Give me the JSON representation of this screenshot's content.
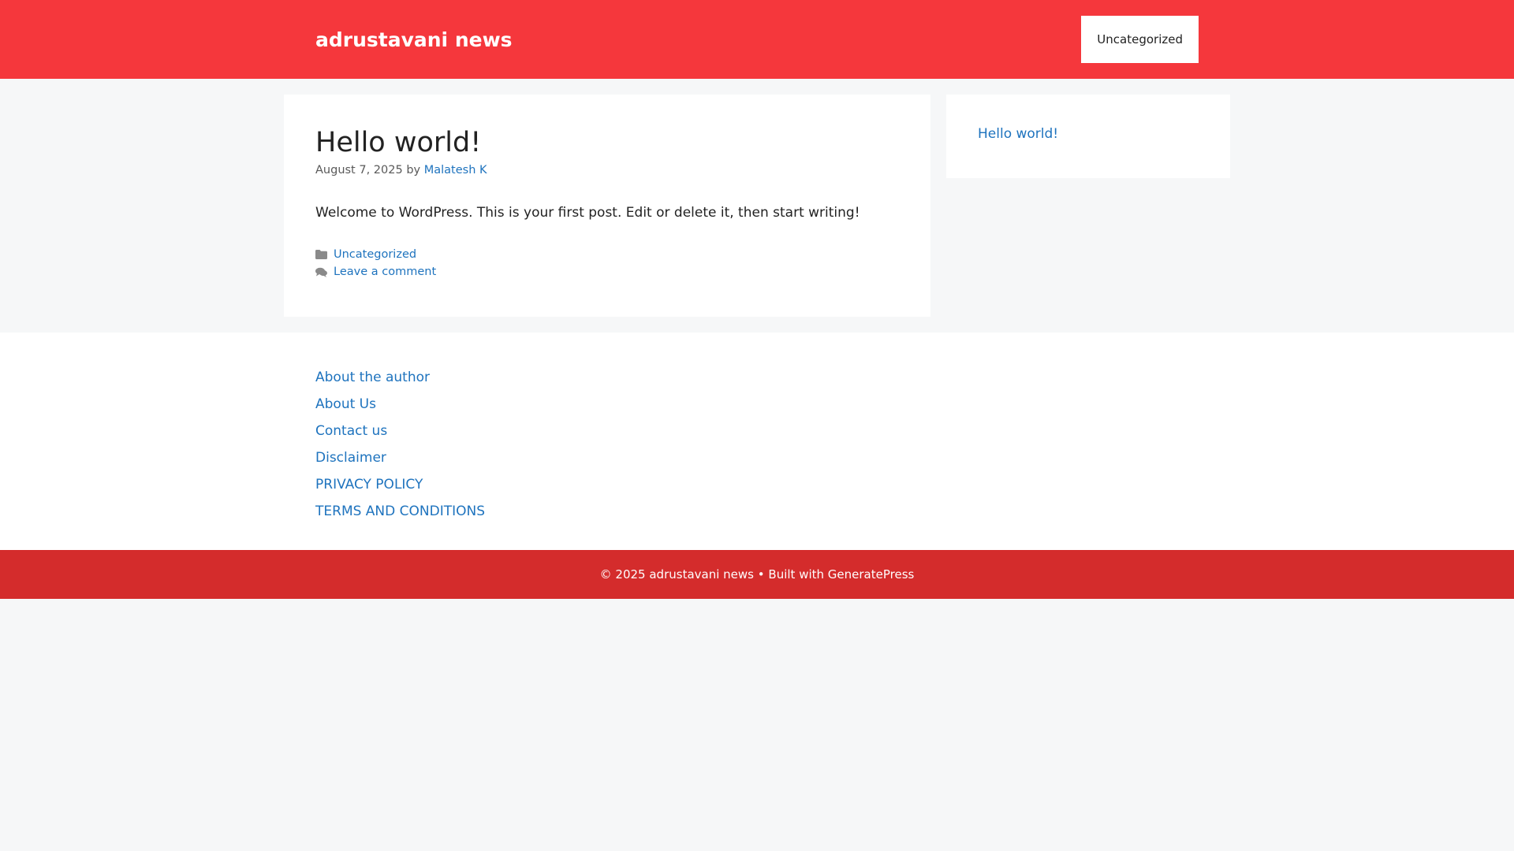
{
  "header": {
    "site_title": "adrustavani news",
    "nav": [
      {
        "label": "Uncategorized"
      }
    ]
  },
  "post": {
    "title": "Hello world!",
    "date": "August 7, 2025",
    "by_label": "by",
    "author": "Malatesh K",
    "content": "Welcome to WordPress. This is your first post. Edit or delete it, then start writing!",
    "category": "Uncategorized",
    "comment_link": "Leave a comment",
    "icons": {
      "category": "folder-icon",
      "comment": "comment-icon"
    }
  },
  "sidebar": {
    "recent_posts": [
      {
        "label": "Hello world!"
      }
    ]
  },
  "footer_widgets": {
    "links": [
      {
        "label": "About the author"
      },
      {
        "label": "About Us"
      },
      {
        "label": "Contact us"
      },
      {
        "label": "Disclaimer"
      },
      {
        "label": "PRIVACY POLICY"
      },
      {
        "label": "TERMS AND CONDITIONS"
      }
    ]
  },
  "site_info": {
    "copyright": "© 2025 adrustavani news",
    "separator": "•",
    "built_with": "Built with",
    "theme_link": "GeneratePress"
  },
  "colors": {
    "header_bg": "#f5373c",
    "footer_bar_bg": "#d42c2c",
    "link": "#1e73be",
    "page_bg": "#f6f7f8"
  }
}
